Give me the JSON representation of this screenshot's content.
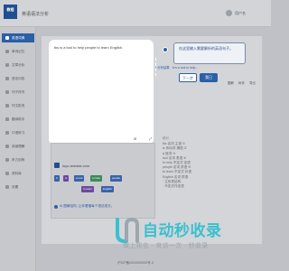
{
  "app": {
    "logo_text": "教程",
    "title": "英语语法分析",
    "user_name": "用户名"
  },
  "sidebar": {
    "items": [
      {
        "label": "英语词典"
      },
      {
        "label": "单词记忆"
      },
      {
        "label": "文章分析"
      },
      {
        "label": "语法问答"
      },
      {
        "label": "句子改写"
      },
      {
        "label": "作文批改"
      },
      {
        "label": "翻译助手"
      },
      {
        "label": "口语练习"
      },
      {
        "label": "阅读理解"
      },
      {
        "label": "听力训练"
      },
      {
        "label": "资料库"
      },
      {
        "label": "设置"
      }
    ],
    "active_index": 0
  },
  "editor": {
    "text": "tks is a tool to help people to learn English."
  },
  "tour": {
    "bubble_text": "在这里输入需要解析的英语句子。",
    "next_label": "下一步",
    "close_label": "我已",
    "crumb": "• 分析结果 · It is a tool to help..."
  },
  "toolbar": {
    "tools": [
      "图解",
      "树状",
      "导出"
    ]
  },
  "panel": {
    "icons": [
      "⊞",
      "⤢"
    ],
    "site_url": "luyu.anestar.com",
    "chips": [
      "It",
      "is",
      "a tool",
      "to help",
      "people",
      "to learn",
      "English"
    ],
    "hint": "AI 图解结构, 让你看懂每个语法成分。"
  },
  "glossary": {
    "title": "统计",
    "lines": [
      "tks 名词 主语 ①",
      "is 系动词 谓语 ②",
      "a 冠词 ③",
      "tool 名词 表语 ④",
      "to help 不定式 定语",
      "people 名词 宾语 ⑤",
      "to learn 不定式 补语",
      "English 名词 宾语",
      "· 主系表结构",
      "· 不定式作定语"
    ]
  },
  "footer": {
    "text": "沪ICP备2024000000号-3"
  },
  "watermark": {
    "brand": "自动秒收录",
    "slogan": "做上排名 · 来访一次 · 秒收录"
  },
  "colors": {
    "accent": "#2b5fa6",
    "brand": "#3ac0cc",
    "chip_blue": "#3a63a8",
    "chip_purple": "#6a4aa0",
    "chip_green": "#3a8a5a"
  }
}
